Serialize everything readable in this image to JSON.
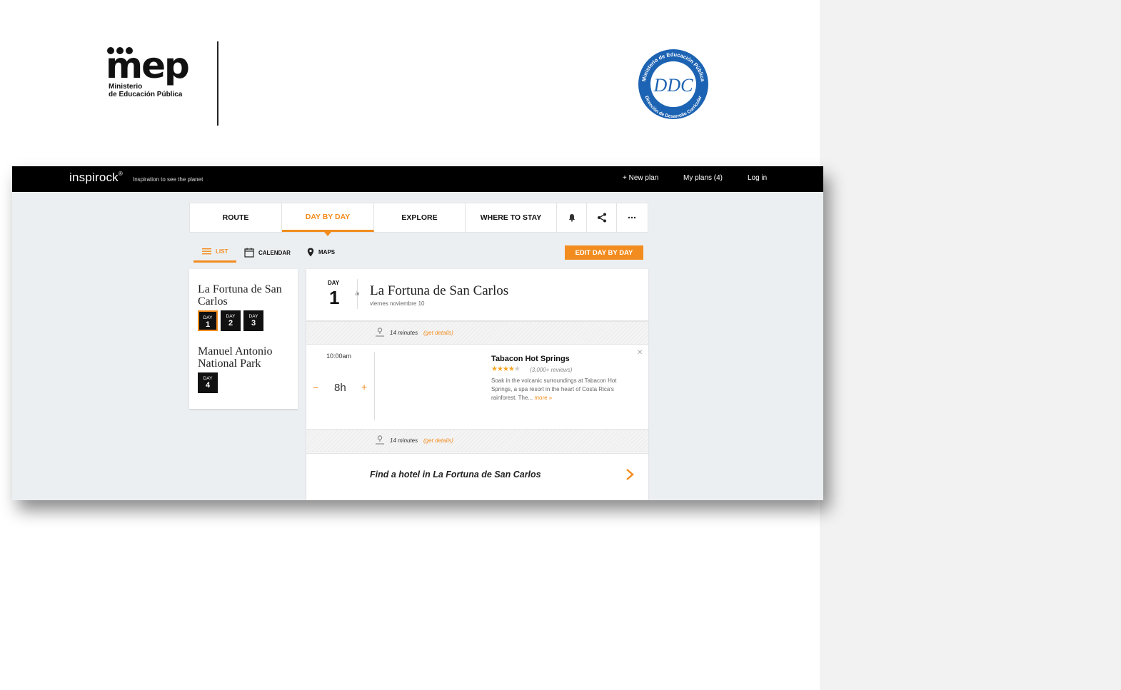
{
  "header": {
    "mep_logo_word": "mep",
    "mep_logo_sub_line1": "Ministerio",
    "mep_logo_sub_line2": "de Educación Pública",
    "ddc_seal_ring_top": "Ministerio de Educación Pública",
    "ddc_seal_ring_bottom": "Dirección de Desarrollo Curricular",
    "ddc_seal_monogram": "DDC"
  },
  "app": {
    "brand_pre": "inspi",
    "brand_post": "rock",
    "brand_mark": "®",
    "tagline": "Inspiration to see the planet",
    "nav": {
      "new_plan": "+ New plan",
      "my_plans": "My plans (4)",
      "log_in": "Log in"
    },
    "tabs": {
      "route": "ROUTE",
      "day_by_day": "DAY BY DAY",
      "explore": "EXPLORE",
      "where_to_stay": "WHERE TO STAY"
    },
    "view": {
      "list": "LIST",
      "calendar": "CALENDAR",
      "maps": "MAPS",
      "edit_button": "EDIT DAY BY DAY"
    },
    "sidebar": {
      "places": [
        {
          "name": "La Fortuna de San Carlos",
          "days": [
            "1",
            "2",
            "3"
          ]
        },
        {
          "name": "Manuel Antonio National Park",
          "days": [
            "4"
          ]
        }
      ],
      "day_label": "DAY"
    },
    "day_header": {
      "day_label": "DAY",
      "day_number": "1",
      "in_label": "in",
      "place": "La Fortuna de San Carlos",
      "date": "viernes noviembre 10"
    },
    "transit": {
      "time": "14 minutes",
      "details_link": "(get details)"
    },
    "activity": {
      "time": "10:00am",
      "duration": "8h",
      "minus": "−",
      "plus": "+",
      "name": "Tabacon Hot Springs",
      "rating": 4,
      "reviews": "(3,000+ reviews)",
      "description": "Soak in the volcanic surroundings at Tabacon Hot Springs, a spa resort in the heart of Costa Rica's rainforest. The...",
      "more": "more »"
    },
    "hotel": {
      "prefix": "Find a hotel in",
      "place": "La Fortuna de San Carlos"
    },
    "colors": {
      "accent": "#f28c1e",
      "topbar": "#000000",
      "background": "#eceff2"
    }
  }
}
